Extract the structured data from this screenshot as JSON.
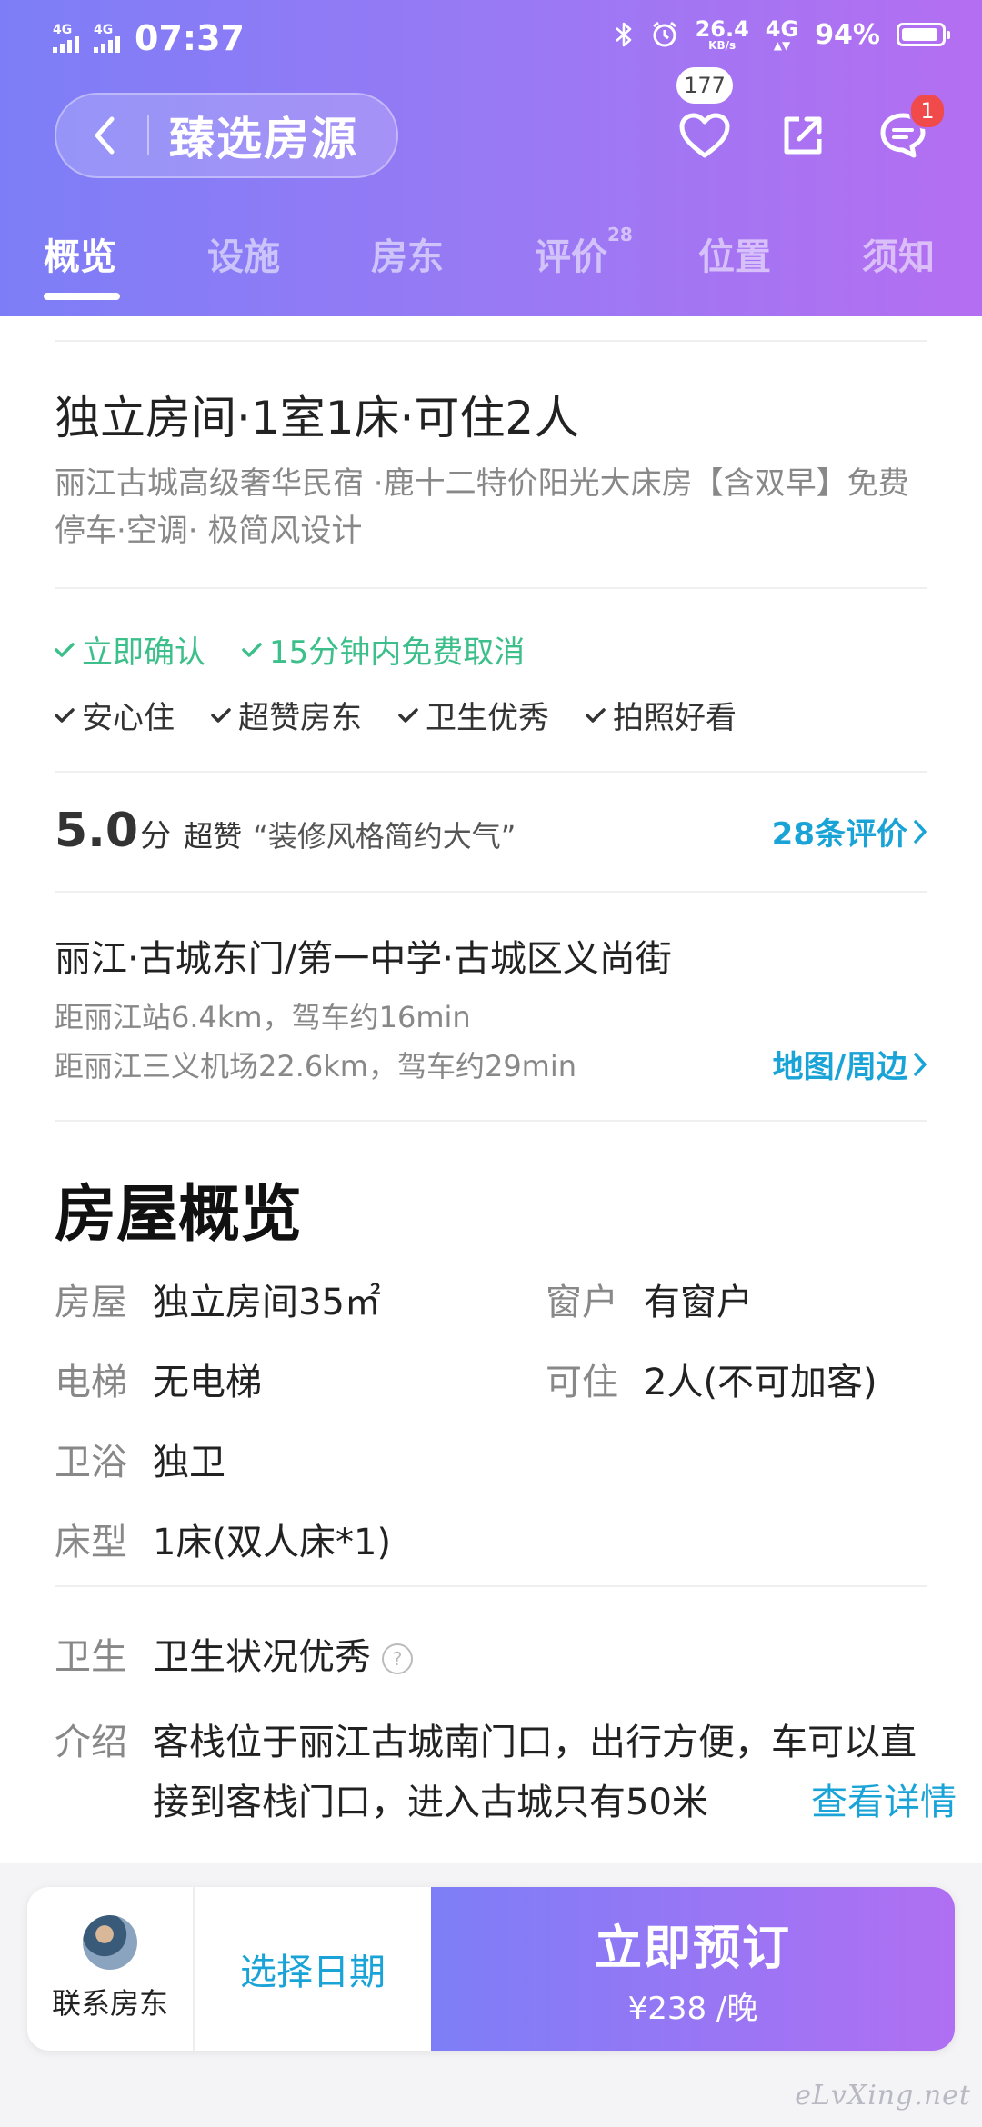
{
  "status_bar": {
    "net1": "4G",
    "net2": "4G",
    "time": "07:37",
    "speed": "26.4",
    "speed_unit": "KB/s",
    "net3": "4G",
    "battery": "94%",
    "battery_level": 0.94
  },
  "header": {
    "title": "臻选房源",
    "favorite_count": "177",
    "message_badge": "1"
  },
  "tabs": [
    {
      "label": "概览",
      "count": ""
    },
    {
      "label": "设施",
      "count": ""
    },
    {
      "label": "房东",
      "count": ""
    },
    {
      "label": "评价",
      "count": "28"
    },
    {
      "label": "位置",
      "count": ""
    },
    {
      "label": "须知",
      "count": ""
    }
  ],
  "listing": {
    "title": "独立房间·1室1床·可住2人",
    "subtitle": "丽江古城高级奢华民宿 ·鹿十二特价阳光大床房【含双早】免费停车·空调· 极简风设计"
  },
  "tags_green": [
    "立即确认",
    "15分钟内免费取消"
  ],
  "tags": [
    "安心住",
    "超赞房东",
    "卫生优秀",
    "拍照好看"
  ],
  "rating": {
    "score": "5.0",
    "unit": "分",
    "label": "超赞",
    "quote": "“装修风格简约大气”",
    "reviews_link": "28条评价"
  },
  "location": {
    "title": "丽江·古城东门/第一中学·古城区义尚街",
    "line1": "距丽江站6.4km，驾车约16min",
    "line2": "距丽江三义机场22.6km，驾车约29min",
    "map_link": "地图/周边"
  },
  "overview": {
    "title": "房屋概览",
    "specs": [
      {
        "key": "房屋",
        "value": "独立房间35㎡"
      },
      {
        "key": "窗户",
        "value": "有窗户"
      },
      {
        "key": "电梯",
        "value": "无电梯"
      },
      {
        "key": "可住",
        "value": "2人(不可加客)"
      },
      {
        "key": "卫浴",
        "value": "独卫"
      },
      {
        "key": "床型",
        "value": "1床(双人床*1)"
      }
    ],
    "hygiene_key": "卫生",
    "hygiene_value": "卫生状况优秀",
    "intro_key": "介绍",
    "intro_value": "客栈位于丽江古城南门口，出行方便，车可以直接到客栈门口，进入古城只有50米",
    "detail_link": "查看详情"
  },
  "bottom_bar": {
    "contact_label": "联系房东",
    "date_label": "选择日期",
    "book_label": "立即预订",
    "price": "¥238 /晚"
  },
  "watermark": "eLvXing.net",
  "colors": {
    "header_gradient_start": "#7d7ef7",
    "header_gradient_end": "#b46ef1",
    "link_blue": "#1aa3d6",
    "tag_green": "#3cbf8a",
    "badge_red": "#f04a4a"
  }
}
